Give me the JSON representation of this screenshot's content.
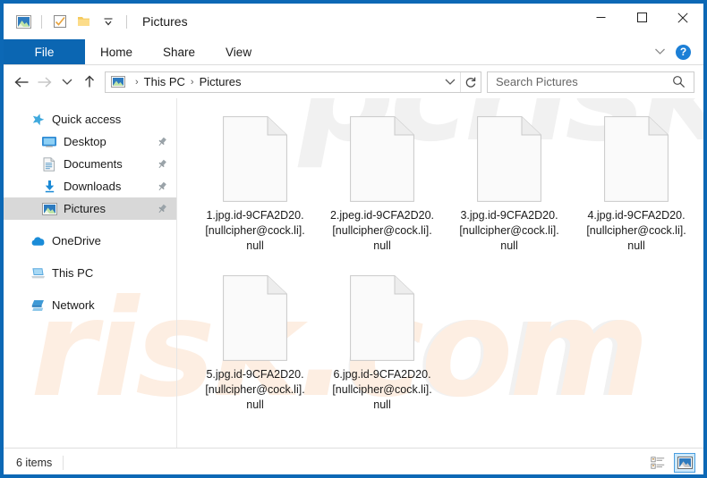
{
  "window": {
    "title": "Pictures",
    "border_color": "#0c68b5",
    "quick_access_toolbar": [
      {
        "name": "pictures-folder-icon",
        "label": "Pictures"
      },
      {
        "name": "properties-icon",
        "label": "Properties"
      },
      {
        "name": "new-folder-icon",
        "label": "New folder"
      },
      {
        "name": "customize-dropdown-icon",
        "label": "Customize Quick Access Toolbar"
      }
    ],
    "controls": [
      {
        "name": "minimize-button",
        "glyph": "minimize"
      },
      {
        "name": "maximize-button",
        "glyph": "maximize"
      },
      {
        "name": "close-button",
        "glyph": "close"
      }
    ]
  },
  "ribbon": {
    "tabs": [
      {
        "label": "File",
        "active_file": true
      },
      {
        "label": "Home",
        "active_file": false
      },
      {
        "label": "Share",
        "active_file": false
      },
      {
        "label": "View",
        "active_file": false
      }
    ],
    "expand_label": "",
    "help_label": "?"
  },
  "nav": {
    "back_label": "Back",
    "forward_label": "Forward",
    "recent_label": "Recent locations",
    "up_label": "Up",
    "refresh_label": "Refresh",
    "breadcrumb": [
      {
        "label": "This PC"
      },
      {
        "label": "Pictures"
      }
    ],
    "separator": "›"
  },
  "search": {
    "placeholder": "Search Pictures",
    "value": ""
  },
  "sidebar": {
    "items": [
      {
        "label": "Quick access",
        "icon": "star-icon",
        "indent": 0,
        "pinned": false,
        "selected": false
      },
      {
        "label": "Desktop",
        "icon": "desktop-icon",
        "indent": 1,
        "pinned": true,
        "selected": false
      },
      {
        "label": "Documents",
        "icon": "documents-icon",
        "indent": 1,
        "pinned": true,
        "selected": false
      },
      {
        "label": "Downloads",
        "icon": "downloads-icon",
        "indent": 1,
        "pinned": true,
        "selected": false
      },
      {
        "label": "Pictures",
        "icon": "pictures-icon",
        "indent": 1,
        "pinned": true,
        "selected": true
      },
      {
        "label": "OneDrive",
        "icon": "onedrive-icon",
        "indent": 0,
        "pinned": false,
        "selected": false
      },
      {
        "label": "This PC",
        "icon": "this-pc-icon",
        "indent": 0,
        "pinned": false,
        "selected": false
      },
      {
        "label": "Network",
        "icon": "network-icon",
        "indent": 0,
        "pinned": false,
        "selected": false
      }
    ]
  },
  "files": [
    {
      "name": "1.jpg.id-9CFA2D20.[nullcipher@cock.li].null",
      "icon": "blank-file-icon"
    },
    {
      "name": "2.jpeg.id-9CFA2D20.[nullcipher@cock.li].null",
      "icon": "blank-file-icon"
    },
    {
      "name": "3.jpg.id-9CFA2D20.[nullcipher@cock.li].null",
      "icon": "blank-file-icon"
    },
    {
      "name": "4.jpg.id-9CFA2D20.[nullcipher@cock.li].null",
      "icon": "blank-file-icon"
    },
    {
      "name": "5.jpg.id-9CFA2D20.[nullcipher@cock.li].null",
      "icon": "blank-file-icon"
    },
    {
      "name": "6.jpg.id-9CFA2D20.[nullcipher@cock.li].null",
      "icon": "blank-file-icon"
    }
  ],
  "status": {
    "item_count": "6 items",
    "view_buttons": [
      {
        "name": "details-view-button",
        "label": "Details view",
        "active": false
      },
      {
        "name": "large-icons-view-button",
        "label": "Large icons view",
        "active": true
      }
    ]
  },
  "watermark": {
    "text_gray_top": "pcrisk",
    "text_gray_bottom": "com",
    "text_orange": "risk.com",
    "gray_color": "#f1f1f1",
    "orange_color": "#fdeee2"
  }
}
